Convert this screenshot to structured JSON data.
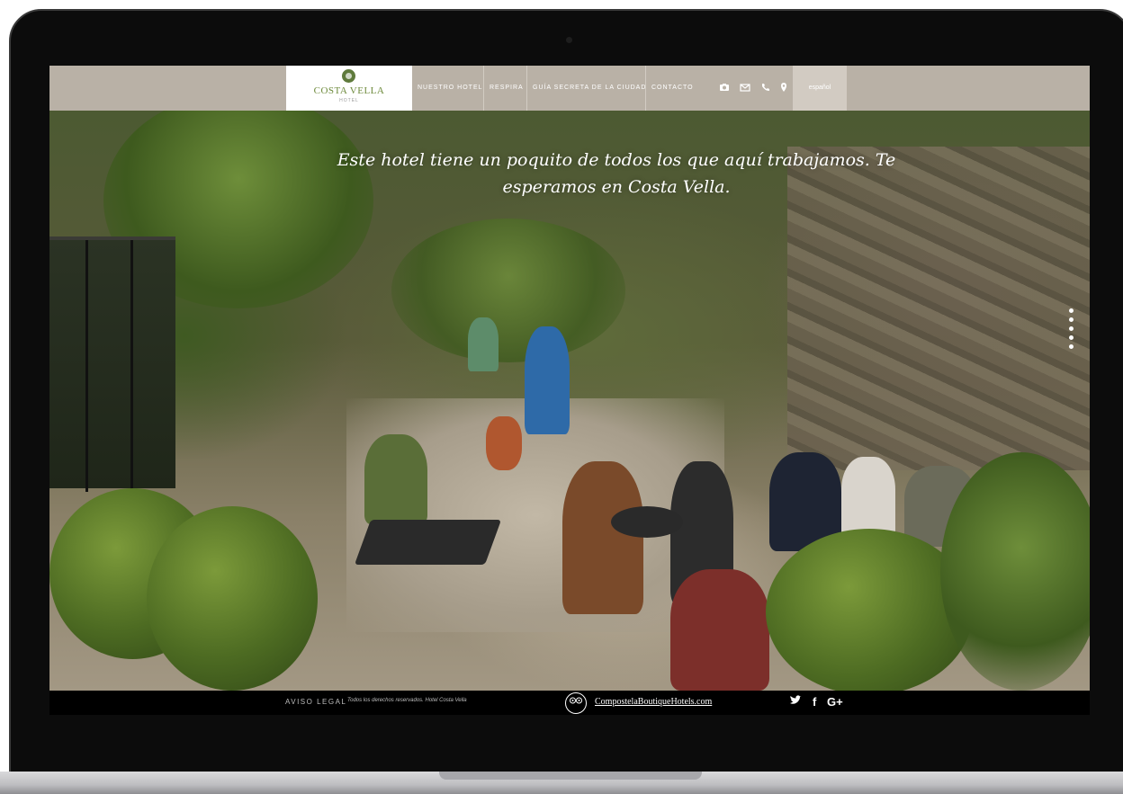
{
  "logo": {
    "name": "COSTA VELLA",
    "sub": "HOTEL"
  },
  "nav": {
    "items": [
      "NUESTRO HOTEL",
      "RESPIRA",
      "GUÍA SECRETA DE LA CIUDAD",
      "CONTACTO"
    ],
    "icons": [
      "camera-icon",
      "mail-icon",
      "phone-icon",
      "location-pin-icon"
    ],
    "language": "español"
  },
  "hero": {
    "quote": "Este hotel tiene un poquito de todos los que aquí trabajamos. Te esperamos en Costa Vella.",
    "slide_count": 5
  },
  "footer": {
    "legal": "AVISO LEGAL",
    "rights": "Todos los derechos reservados. Hotel Costa Vella",
    "brand": "CompostelaBoutiqueHotels.com",
    "social": [
      "twitter-icon",
      "facebook-icon",
      "google-plus-icon"
    ]
  },
  "colors": {
    "topbar": "#b9b1a6",
    "logo_green": "#6d8a3b",
    "footer": "#000000"
  }
}
